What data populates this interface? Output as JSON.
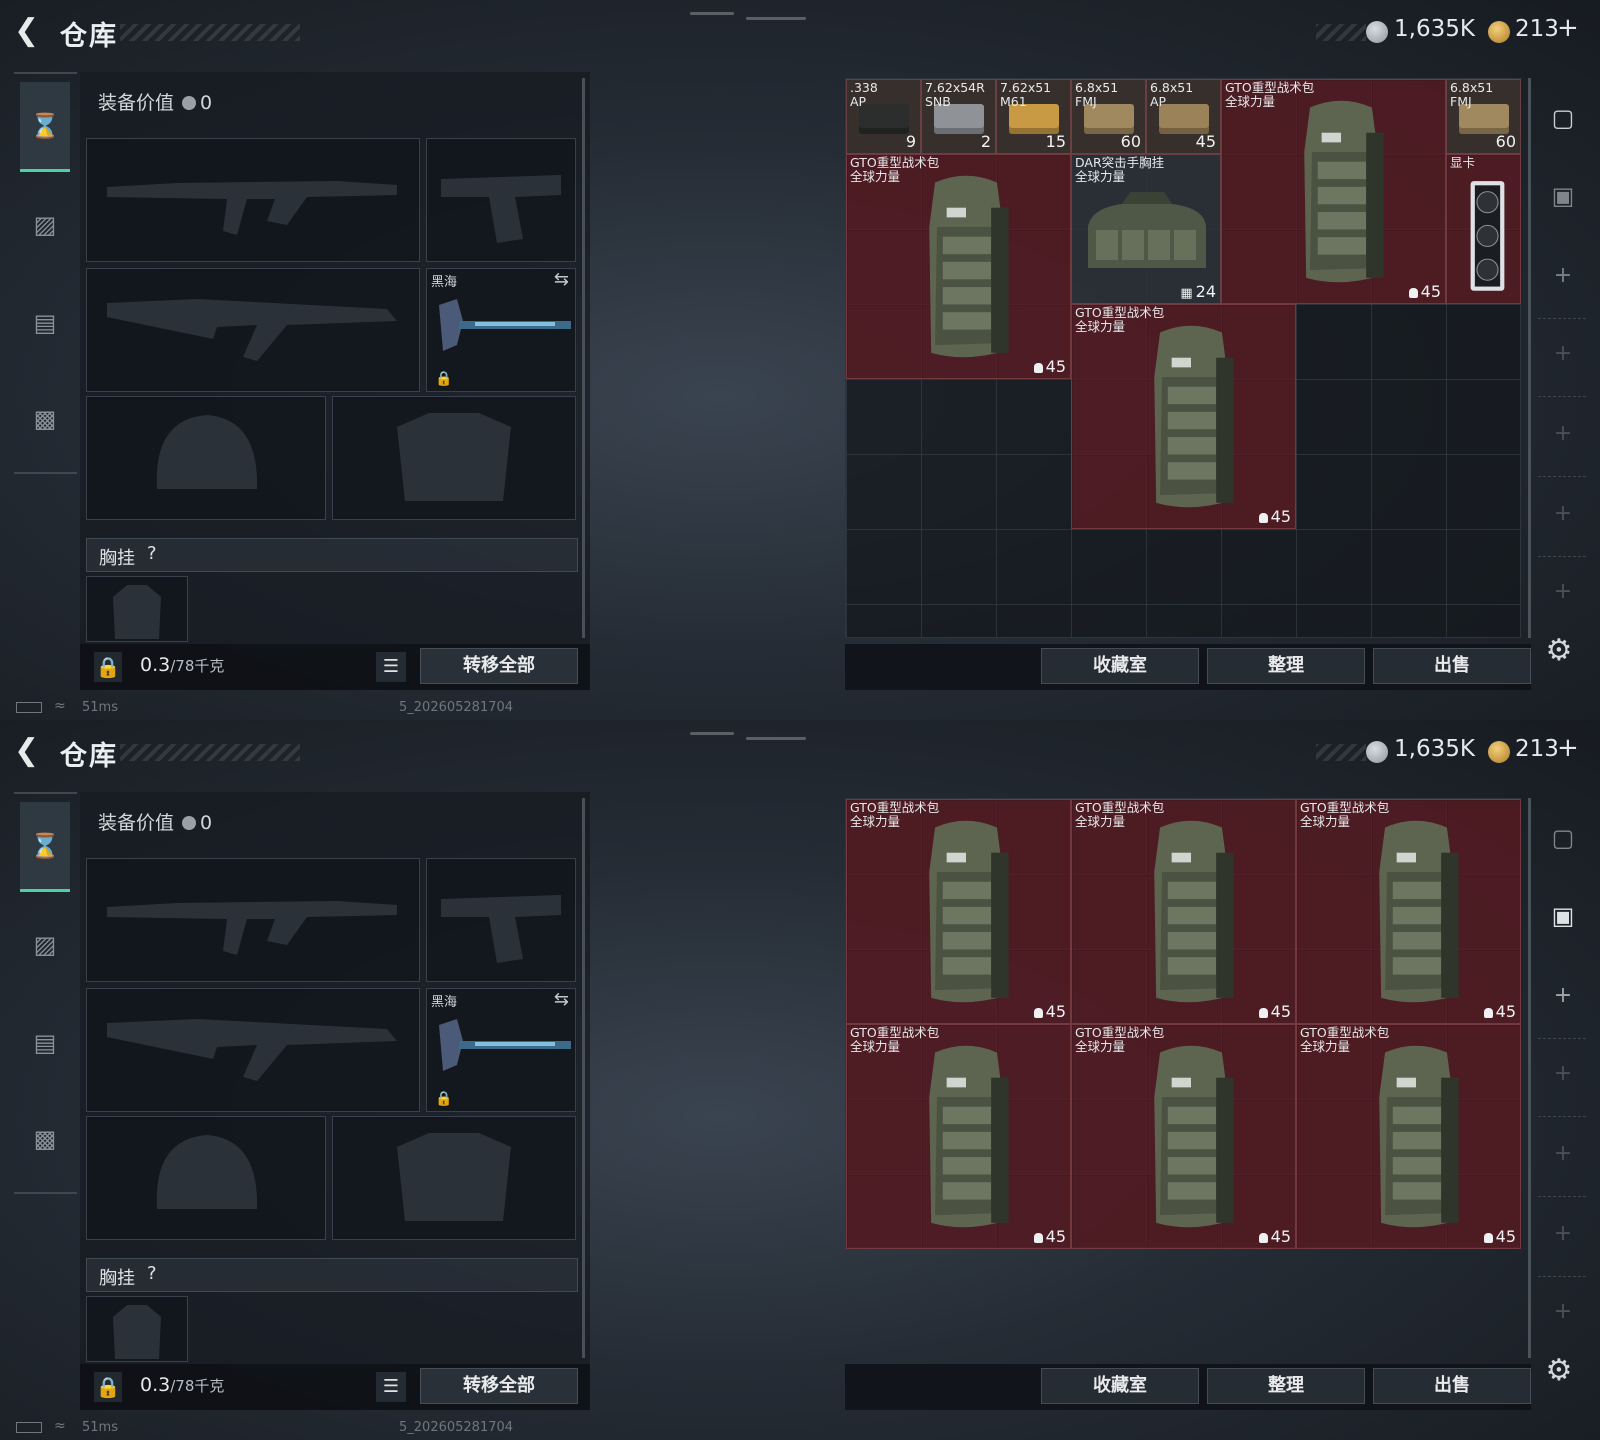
{
  "header": {
    "back_icon": "arrow-left-icon",
    "title": "仓库",
    "silver_amount": "1,635K",
    "gold_amount": "213",
    "gold_plus": "+"
  },
  "colors": {
    "accent": "#4fd0a4",
    "item_bg": "#5c1c24",
    "silver_coin": "#9aa0a6",
    "gold_coin": "#c9963a"
  },
  "sidebar": {
    "items": [
      {
        "icon": "pistol-icon",
        "active": true
      },
      {
        "icon": "backpack-icon",
        "active": false
      },
      {
        "icon": "canister-icon",
        "active": false
      },
      {
        "icon": "toolbox-icon",
        "active": false
      }
    ]
  },
  "equipment": {
    "value_label": "装备价值",
    "value": "0",
    "slots": [
      {
        "type": "primary-weapon",
        "icon": "rifle-icon"
      },
      {
        "type": "sidearm",
        "icon": "pistol-icon"
      },
      {
        "type": "secondary-weapon",
        "icon": "rifle-icon"
      },
      {
        "type": "melee",
        "name": "黑海",
        "icon": "axe-icon",
        "swap_icon": "swap-icon",
        "lock_icon": "lock-icon"
      },
      {
        "type": "helmet",
        "icon": "helmet-icon"
      },
      {
        "type": "armor",
        "icon": "armor-icon"
      }
    ],
    "chest_label": "胸挂",
    "chest_help": "?",
    "weight": "0.3",
    "weight_max": "/78千克",
    "transfer_all": "转移全部"
  },
  "stash_buttons": {
    "collection": "收藏室",
    "organize": "整理",
    "sell": "出售"
  },
  "status_bar": {
    "ping": "51ms",
    "build": "5_202605281704"
  },
  "screens": [
    {
      "id": "top",
      "items": [
        {
          "name": ".338\nAP",
          "count": "9",
          "kind": "ammo"
        },
        {
          "name": "7.62x54R\nSNB",
          "count": "2",
          "kind": "ammo"
        },
        {
          "name": "7.62x51\nM61",
          "count": "15",
          "kind": "ammo"
        },
        {
          "name": "6.8x51\nFMJ",
          "count": "60",
          "kind": "ammo"
        },
        {
          "name": "6.8x51\nAP",
          "count": "45",
          "kind": "ammo"
        },
        {
          "name": "GTO重型战术包\n全球力量",
          "count": "45",
          "kind": "backpack"
        },
        {
          "name": "6.8x51\nFMJ",
          "count": "60",
          "kind": "ammo"
        },
        {
          "name": "GTO重型战术包\n全球力量",
          "count": "45",
          "kind": "backpack"
        },
        {
          "name": "DAR突击手胸挂\n全球力量",
          "count": "24",
          "kind": "chest-rig"
        },
        {
          "name": "显卡",
          "count": "",
          "kind": "gpu"
        },
        {
          "name": "GTO重型战术包\n全球力量",
          "count": "45",
          "kind": "backpack"
        }
      ]
    },
    {
      "id": "bottom",
      "items": [
        {
          "name": "GTO重型战术包\n全球力量",
          "count": "45",
          "kind": "backpack"
        },
        {
          "name": "GTO重型战术包\n全球力量",
          "count": "45",
          "kind": "backpack"
        },
        {
          "name": "GTO重型战术包\n全球力量",
          "count": "45",
          "kind": "backpack"
        },
        {
          "name": "GTO重型战术包\n全球力量",
          "count": "45",
          "kind": "backpack"
        },
        {
          "name": "GTO重型战术包\n全球力量",
          "count": "45",
          "kind": "backpack"
        },
        {
          "name": "GTO重型战术包\n全球力量",
          "count": "45",
          "kind": "backpack"
        }
      ]
    }
  ]
}
